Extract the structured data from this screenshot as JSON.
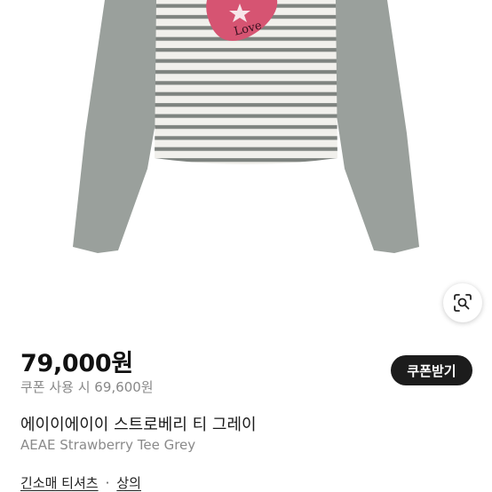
{
  "product": {
    "price": "79,000원",
    "coupon_price_text": "쿠폰 사용 시 69,600원",
    "coupon_button_label": "쿠폰받기",
    "title_ko": "에이이에이이 스트로베리 티 그레이",
    "title_en": "AEAE Strawberry Tee Grey",
    "categories": [
      "긴소매 티셔츠",
      "상의"
    ],
    "category_separator": "·"
  },
  "image": {
    "print_text": "Love",
    "colors": {
      "sleeve": "#9aa09c",
      "stripe": "#7e837f",
      "body": "#f1f0ec",
      "strawberry": "#d65472"
    }
  },
  "icons": {
    "lens": "lens-search-icon"
  }
}
